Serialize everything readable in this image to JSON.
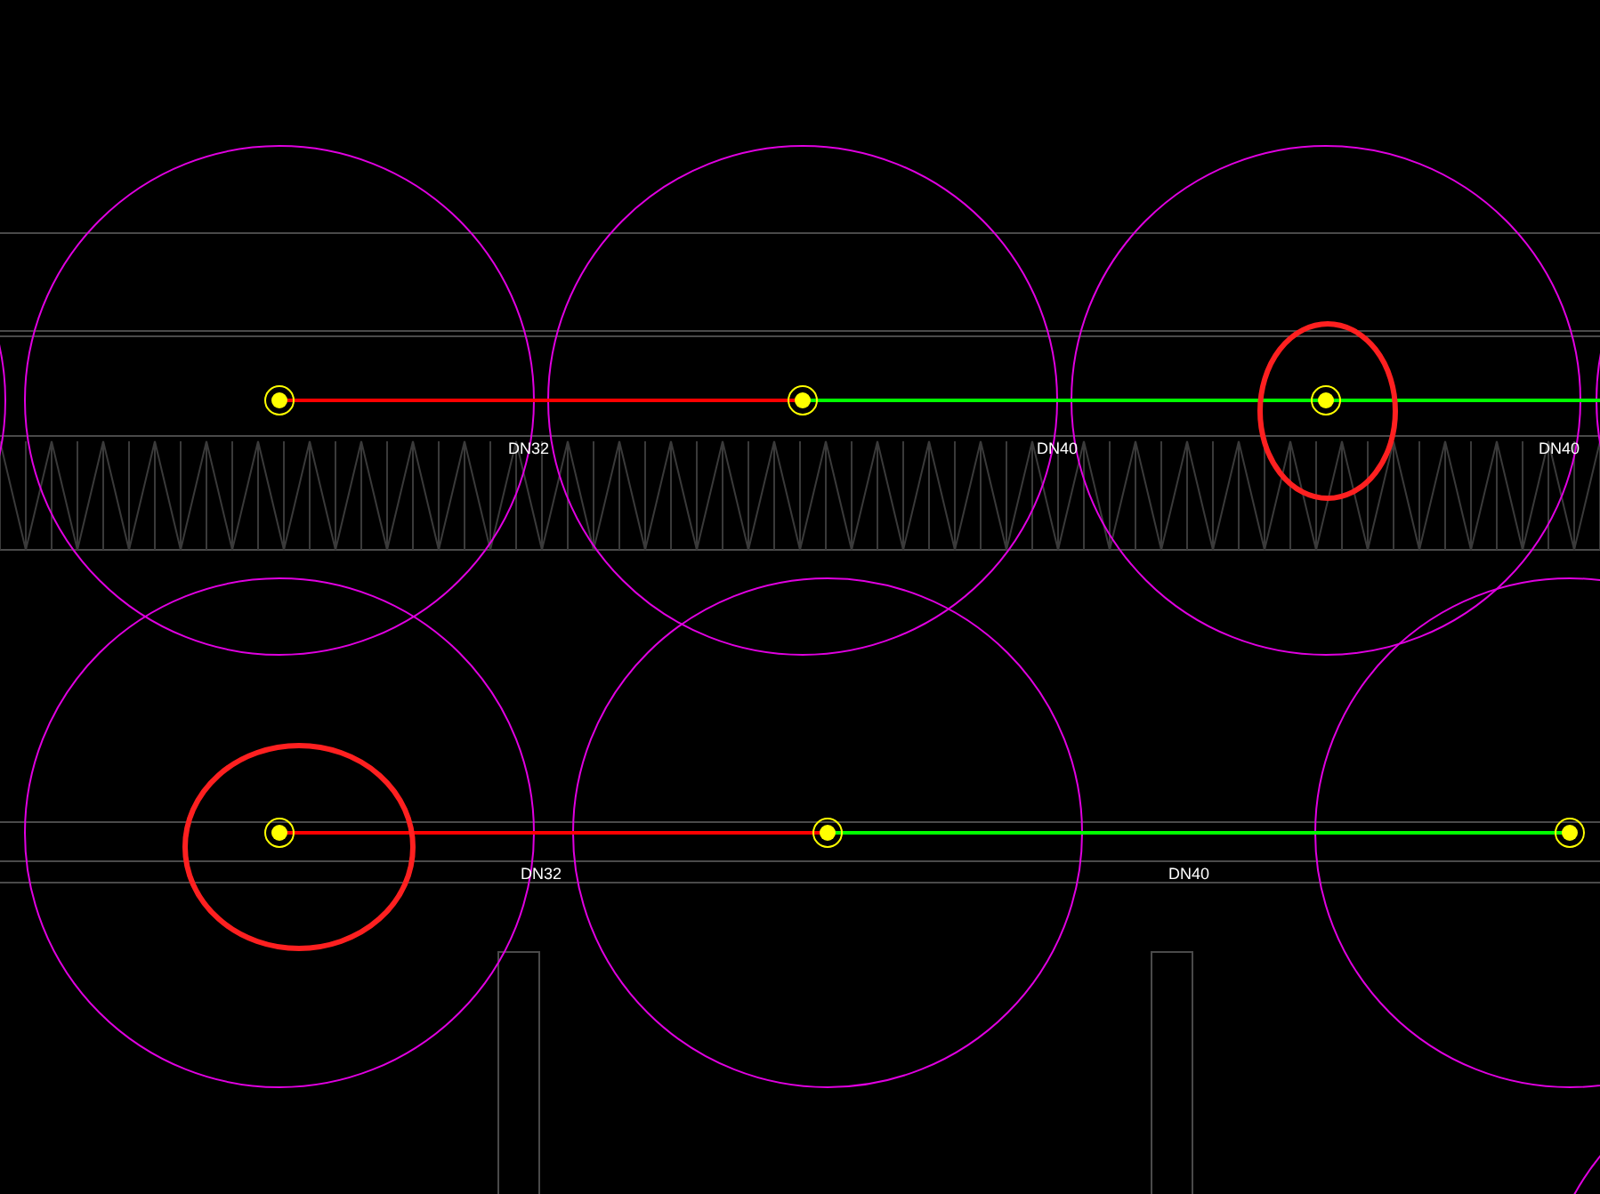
{
  "pipe_runs": [
    {
      "nodes": [
        {
          "highlighted": false
        },
        {
          "highlighted": false
        },
        {
          "highlighted": true
        }
      ],
      "segments": [
        {
          "label": "DN32",
          "color": "#ff0000"
        },
        {
          "label": "DN40",
          "color": "#00ff00"
        },
        {
          "label": "DN40",
          "color": "#00ff00"
        }
      ]
    },
    {
      "nodes": [
        {
          "highlighted": true
        },
        {
          "highlighted": false
        },
        {
          "highlighted": false
        }
      ],
      "segments": [
        {
          "label": "DN32",
          "color": "#ff0000"
        },
        {
          "label": "DN40",
          "color": "#00ff00"
        }
      ]
    }
  ]
}
